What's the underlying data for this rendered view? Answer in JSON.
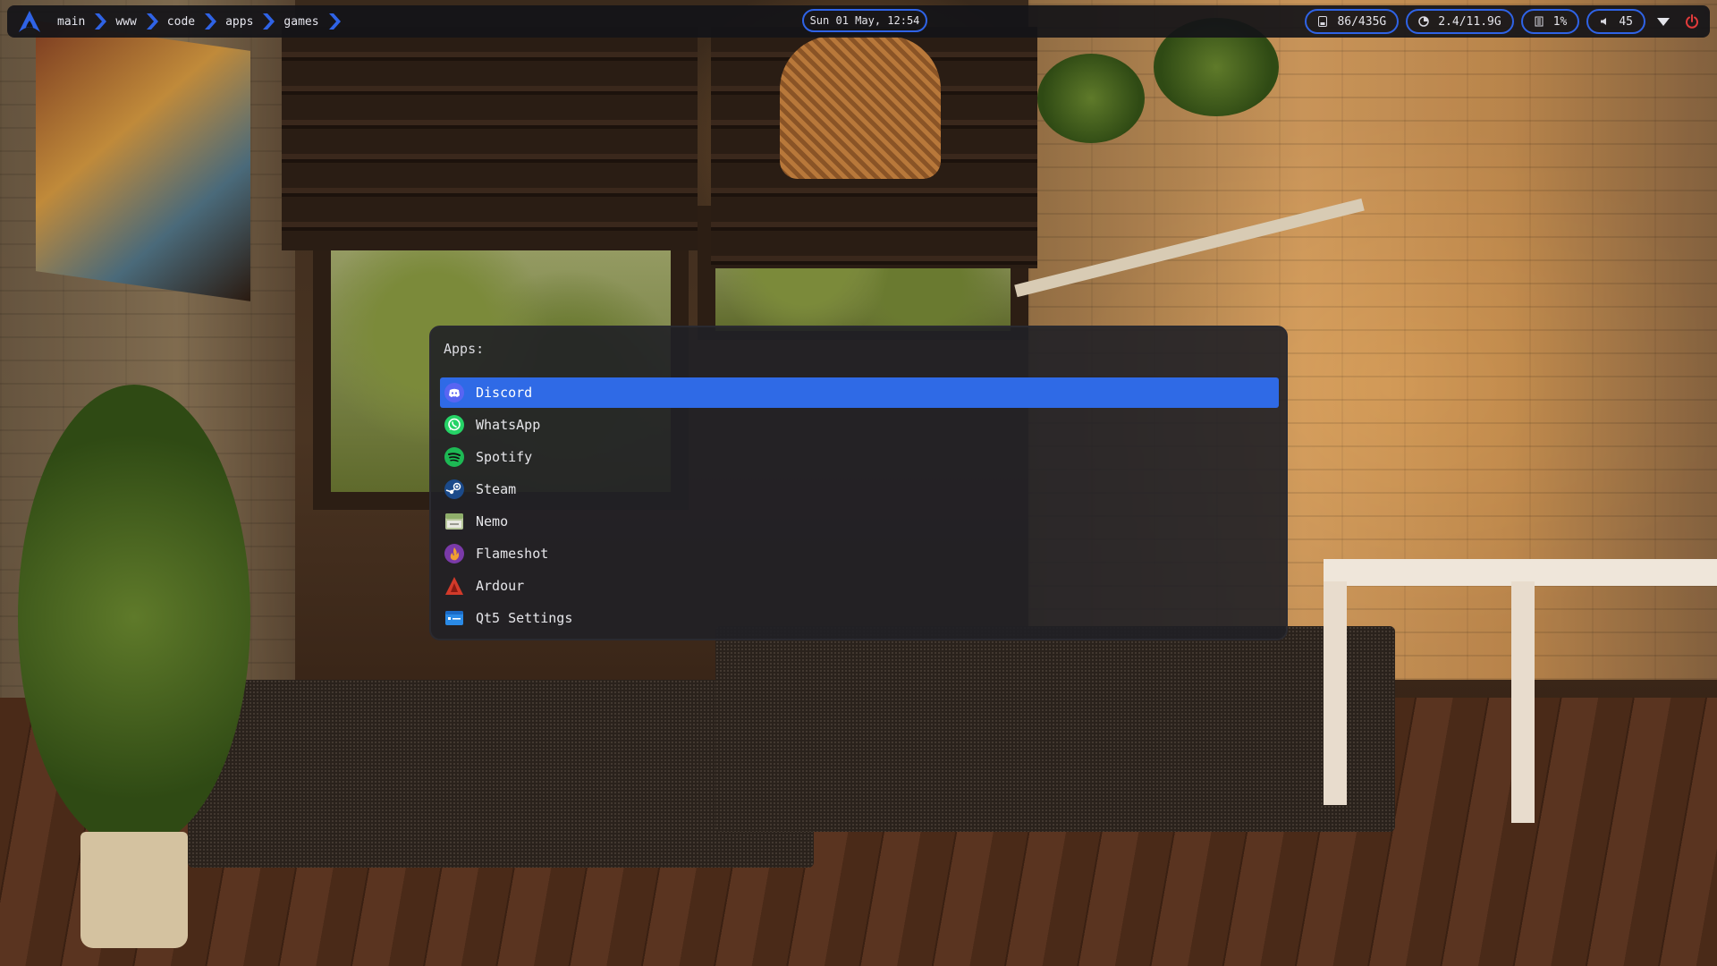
{
  "topbar": {
    "logo_icon": "arch-linux-logo-icon",
    "breadcrumbs": [
      "main",
      "www",
      "code",
      "apps",
      "games"
    ],
    "clock": "Sun 01 May, 12:54",
    "disk": "86/435G",
    "memory": "2.4/11.9G",
    "cpu": "1%",
    "volume": "45",
    "accent_color": "#2f63e6"
  },
  "launcher": {
    "prompt": "Apps:",
    "selected_index": 0,
    "highlight_color": "#2f6ae6",
    "items": [
      {
        "label": "Discord",
        "icon": "discord-icon"
      },
      {
        "label": "WhatsApp",
        "icon": "whatsapp-icon"
      },
      {
        "label": "Spotify",
        "icon": "spotify-icon"
      },
      {
        "label": "Steam",
        "icon": "steam-icon"
      },
      {
        "label": "Nemo",
        "icon": "nemo-file-manager-icon"
      },
      {
        "label": "Flameshot",
        "icon": "flameshot-icon"
      },
      {
        "label": "Ardour",
        "icon": "ardour-icon"
      },
      {
        "label": "Qt5 Settings",
        "icon": "qt5-settings-icon"
      }
    ]
  }
}
